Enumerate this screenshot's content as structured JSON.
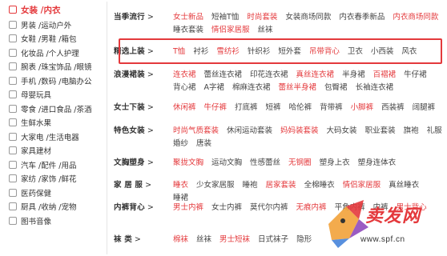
{
  "sidebar": {
    "items": [
      {
        "label": "女装 /内衣",
        "icon": "dress-icon",
        "active": true
      },
      {
        "label": "男装 /运动户外",
        "icon": "shirt-icon"
      },
      {
        "label": "女鞋 /男鞋 /箱包",
        "icon": "bag-icon"
      },
      {
        "label": "化妆品 /个人护理",
        "icon": "cosmetics-icon"
      },
      {
        "label": "腕表 /珠宝饰品 /眼镜",
        "icon": "diamond-icon"
      },
      {
        "label": "手机 /数码 /电脑办公",
        "icon": "phone-icon"
      },
      {
        "label": "母婴玩具",
        "icon": "baby-icon"
      },
      {
        "label": "零食 /进口食品 /茶酒",
        "icon": "snack-icon"
      },
      {
        "label": "生鲜水果",
        "icon": "fruit-icon"
      },
      {
        "label": "大家电 /生活电器",
        "icon": "appliance-icon"
      },
      {
        "label": "家具建材",
        "icon": "furniture-icon"
      },
      {
        "label": "汽车 /配件 /用品",
        "icon": "car-icon"
      },
      {
        "label": "家纺 /家饰 /鲜花",
        "icon": "home-textile-icon"
      },
      {
        "label": "医药保健",
        "icon": "medicine-icon"
      },
      {
        "label": "厨具 /收纳 /宠物",
        "icon": "kitchen-icon"
      },
      {
        "label": "图书音像",
        "icon": "book-icon"
      }
    ]
  },
  "categories": [
    {
      "title": "当季流行",
      "arrow": ">",
      "links": [
        {
          "t": "女士新品",
          "hot": true
        },
        {
          "t": "短袖T恤"
        },
        {
          "t": "时尚套装",
          "hot": true
        },
        {
          "t": "女装商场同款"
        },
        {
          "t": "内衣春季新品"
        },
        {
          "t": "内衣商场同款",
          "hot": true
        },
        {
          "t": "睡衣套装"
        },
        {
          "t": "情侣家居服",
          "hot": true
        },
        {
          "t": "丝袜"
        }
      ]
    },
    {
      "title": "精选上装",
      "arrow": ">",
      "links": [
        {
          "t": "T恤",
          "hot": true
        },
        {
          "t": "衬衫"
        },
        {
          "t": "雪纺衫",
          "hot": true
        },
        {
          "t": "针织衫"
        },
        {
          "t": "短外套"
        },
        {
          "t": "吊带背心",
          "hot": true
        },
        {
          "t": "卫衣"
        },
        {
          "t": "小西装"
        },
        {
          "t": "风衣"
        }
      ]
    },
    {
      "title": "浪漫裙装",
      "arrow": ">",
      "links": [
        {
          "t": "连衣裙",
          "hot": true
        },
        {
          "t": "蕾丝连衣裙"
        },
        {
          "t": "印花连衣裙"
        },
        {
          "t": "真丝连衣裙",
          "hot": true
        },
        {
          "t": "半身裙"
        },
        {
          "t": "百褶裙",
          "hot": true
        },
        {
          "t": "牛仔裙"
        },
        {
          "t": "背心裙"
        },
        {
          "t": "A字裙"
        },
        {
          "t": "棉麻连衣裙"
        },
        {
          "t": "蕾丝半身裙",
          "hot": true
        },
        {
          "t": "包臀裙"
        },
        {
          "t": "长袖连衣裙"
        }
      ]
    },
    {
      "title": "女士下装",
      "arrow": ">",
      "links": [
        {
          "t": "休闲裤",
          "hot": true
        },
        {
          "t": "牛仔裤",
          "hot": true
        },
        {
          "t": "打底裤"
        },
        {
          "t": "短裤"
        },
        {
          "t": "哈伦裤"
        },
        {
          "t": "背带裤"
        },
        {
          "t": "小脚裤",
          "hot": true
        },
        {
          "t": "西装裤"
        },
        {
          "t": "阔腿裤"
        }
      ]
    },
    {
      "title": "特色女装",
      "arrow": ">",
      "links": [
        {
          "t": "时尚气质套装",
          "hot": true
        },
        {
          "t": "休闲运动套装"
        },
        {
          "t": "妈妈装套装",
          "hot": true
        },
        {
          "t": "大码女装"
        },
        {
          "t": "职业套装"
        },
        {
          "t": "旗袍"
        },
        {
          "t": "礼服"
        },
        {
          "t": "婚纱"
        },
        {
          "t": "唐装"
        }
      ]
    },
    {
      "title": "文胸塑身",
      "arrow": ">",
      "links": [
        {
          "t": "聚拢文胸",
          "hot": true
        },
        {
          "t": "运动文胸"
        },
        {
          "t": "性感蕾丝"
        },
        {
          "t": "无钢圈",
          "hot": true
        },
        {
          "t": "塑身上衣"
        },
        {
          "t": "塑身连体衣"
        }
      ]
    },
    {
      "title": "家 居 服",
      "arrow": ">",
      "links": [
        {
          "t": "睡衣",
          "hot": true
        },
        {
          "t": "少女家居服"
        },
        {
          "t": "睡袍"
        },
        {
          "t": "居家套装",
          "hot": true
        },
        {
          "t": "全棉睡衣"
        },
        {
          "t": "情侣家居服",
          "hot": true
        },
        {
          "t": "真丝睡衣"
        },
        {
          "t": "睡裙"
        }
      ]
    },
    {
      "title": "内裤背心",
      "arrow": ">",
      "links": [
        {
          "t": "男士内裤",
          "hot": true
        },
        {
          "t": "女士内裤"
        },
        {
          "t": "莫代尔内裤"
        },
        {
          "t": "无痕内裤",
          "hot": true
        },
        {
          "t": "平角内裤"
        },
        {
          "t": "内裤"
        },
        {
          "t": "男士背心",
          "hot": true
        }
      ]
    },
    {
      "title": "袜    类",
      "arrow": ">",
      "links": [
        {
          "t": "棉袜",
          "hot": true
        },
        {
          "t": "丝袜"
        },
        {
          "t": "男士短袜",
          "hot": true
        },
        {
          "t": "日式袜子"
        },
        {
          "t": "隐形"
        }
      ]
    }
  ],
  "watermark": {
    "text": "卖发网",
    "url": "www.spf.cn"
  }
}
